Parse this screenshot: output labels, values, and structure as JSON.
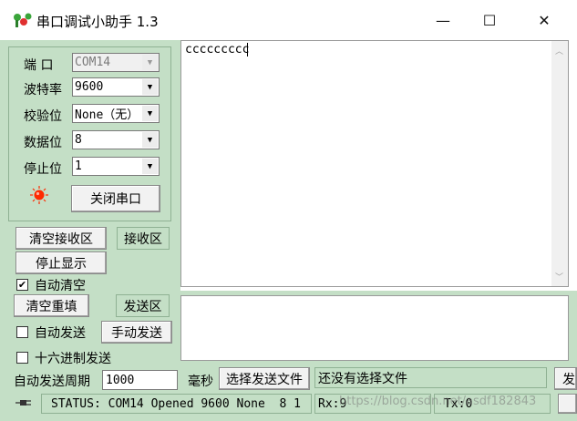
{
  "window": {
    "title": "串口调试小助手 1.3",
    "minimize_icon": "—",
    "maximize_icon": "☐",
    "close_icon": "✕"
  },
  "settings": {
    "port_label": "端  口",
    "port_value": "COM14",
    "baud_label": "波特率",
    "baud_value": "9600",
    "parity_label": "校验位",
    "parity_value": "None（无）",
    "databits_label": "数据位",
    "databits_value": "8",
    "stopbits_label": "停止位",
    "stopbits_value": "1",
    "status_led_color": "#ff2a00",
    "close_port_button": "关闭串口"
  },
  "receive": {
    "clear_button": "清空接收区",
    "area_label": "接收区",
    "stop_display_button": "停止显示",
    "auto_clear_label": "自动清空",
    "auto_clear_checked": true,
    "content": "ccccccccc"
  },
  "send": {
    "clear_button": "清空重填",
    "area_label": "发送区",
    "auto_send_label": "自动发送",
    "auto_send_checked": false,
    "manual_send_button": "手动发送",
    "hex_send_label": "十六进制发送",
    "hex_send_checked": false,
    "period_label": "自动发送周期",
    "period_value": "1000",
    "period_unit": "毫秒",
    "select_file_button": "选择发送文件",
    "file_status": "还没有选择文件",
    "send_file_button_partial": "发"
  },
  "statusbar": {
    "status_text": "STATUS: COM14 Opened 9600 None  8 1",
    "rx_text": "Rx:9",
    "tx_text": "Tx:0",
    "watermark": "https://blog.csdn.net/asdf182843"
  }
}
